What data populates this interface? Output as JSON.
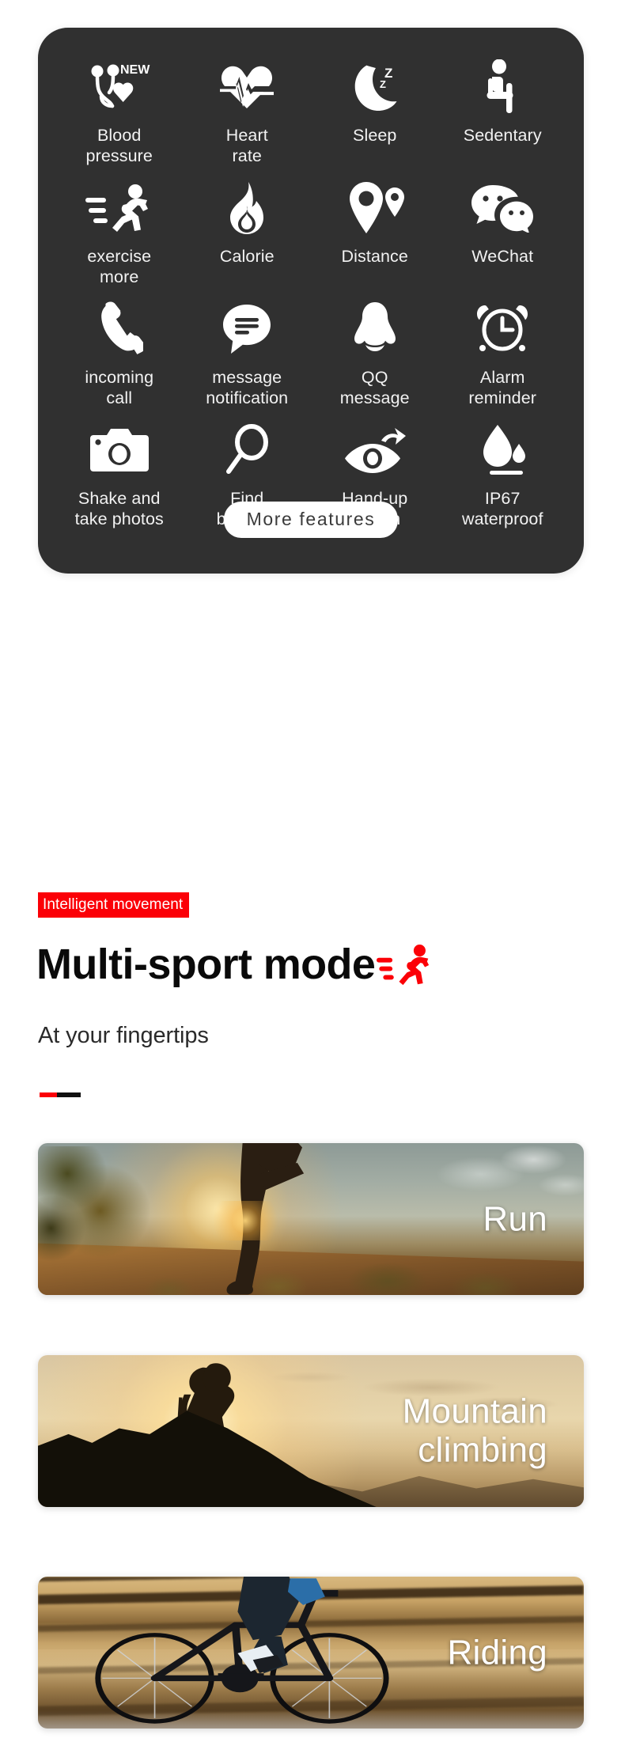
{
  "feature_card": {
    "features": [
      {
        "label": "Blood\npressure",
        "icon": "stethoscope-heart-icon",
        "badge": "NEW"
      },
      {
        "label": "Heart\nrate",
        "icon": "heart-pulse-icon"
      },
      {
        "label": "Sleep",
        "icon": "moon-zzz-icon"
      },
      {
        "label": "Sedentary",
        "icon": "sitting-person-icon"
      },
      {
        "label": "exercise\nmore",
        "icon": "running-person-icon"
      },
      {
        "label": "Calorie",
        "icon": "flame-icon"
      },
      {
        "label": "Distance",
        "icon": "map-pin-icon"
      },
      {
        "label": "WeChat",
        "icon": "wechat-icon"
      },
      {
        "label": "incoming\ncall",
        "icon": "phone-handset-icon"
      },
      {
        "label": "message\nnotification",
        "icon": "message-bubble-icon"
      },
      {
        "label": "QQ\nmessage",
        "icon": "qq-penguin-icon"
      },
      {
        "label": "Alarm\nreminder",
        "icon": "alarm-clock-icon"
      },
      {
        "label": "Shake and\ntake photos",
        "icon": "camera-icon"
      },
      {
        "label": "Find\nbracelet",
        "icon": "magnifier-icon"
      },
      {
        "label": "Hand-up\nscreen",
        "icon": "eye-raise-icon"
      },
      {
        "label": "IP67\nwaterproof",
        "icon": "water-drop-icon"
      }
    ],
    "more_button": "More features"
  },
  "sport_section": {
    "tagline": "Intelligent movement",
    "headline": "Multi-sport mode",
    "headline_icon": "running-person-red-icon",
    "subhead": "At your fingertips",
    "cards": [
      {
        "title": "Run",
        "art": "runner-at-sunset-photo"
      },
      {
        "title": "Mountain\nclimbing",
        "art": "hiker-on-ridge-photo"
      },
      {
        "title": "Riding",
        "art": "road-cyclist-photo"
      }
    ]
  },
  "colors": {
    "card_bg": "#303030",
    "accent_red": "#fb0007",
    "label_text": "#f2f2f2",
    "page_bg": "#ffffff"
  }
}
